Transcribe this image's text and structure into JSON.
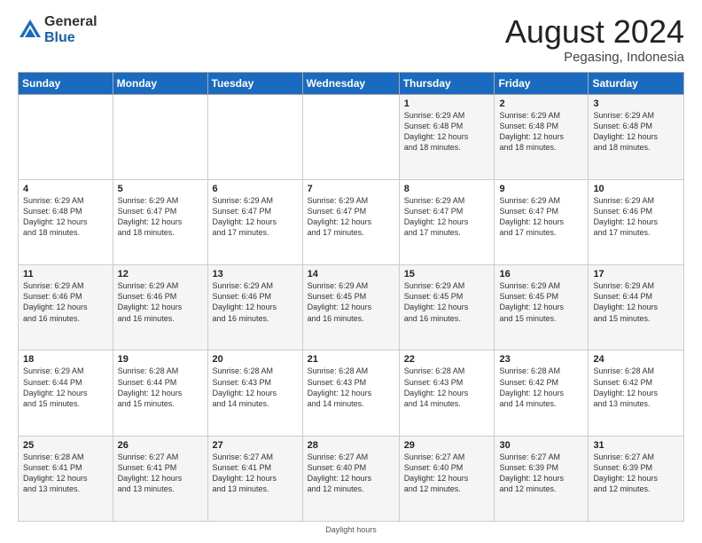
{
  "header": {
    "logo_line1": "General",
    "logo_line2": "Blue",
    "month": "August 2024",
    "location": "Pegasing, Indonesia"
  },
  "days_of_week": [
    "Sunday",
    "Monday",
    "Tuesday",
    "Wednesday",
    "Thursday",
    "Friday",
    "Saturday"
  ],
  "footer": {
    "label": "Daylight hours"
  },
  "weeks": [
    [
      {
        "day": "",
        "info": ""
      },
      {
        "day": "",
        "info": ""
      },
      {
        "day": "",
        "info": ""
      },
      {
        "day": "",
        "info": ""
      },
      {
        "day": "1",
        "info": "Sunrise: 6:29 AM\nSunset: 6:48 PM\nDaylight: 12 hours\nand 18 minutes."
      },
      {
        "day": "2",
        "info": "Sunrise: 6:29 AM\nSunset: 6:48 PM\nDaylight: 12 hours\nand 18 minutes."
      },
      {
        "day": "3",
        "info": "Sunrise: 6:29 AM\nSunset: 6:48 PM\nDaylight: 12 hours\nand 18 minutes."
      }
    ],
    [
      {
        "day": "4",
        "info": "Sunrise: 6:29 AM\nSunset: 6:48 PM\nDaylight: 12 hours\nand 18 minutes."
      },
      {
        "day": "5",
        "info": "Sunrise: 6:29 AM\nSunset: 6:47 PM\nDaylight: 12 hours\nand 18 minutes."
      },
      {
        "day": "6",
        "info": "Sunrise: 6:29 AM\nSunset: 6:47 PM\nDaylight: 12 hours\nand 17 minutes."
      },
      {
        "day": "7",
        "info": "Sunrise: 6:29 AM\nSunset: 6:47 PM\nDaylight: 12 hours\nand 17 minutes."
      },
      {
        "day": "8",
        "info": "Sunrise: 6:29 AM\nSunset: 6:47 PM\nDaylight: 12 hours\nand 17 minutes."
      },
      {
        "day": "9",
        "info": "Sunrise: 6:29 AM\nSunset: 6:47 PM\nDaylight: 12 hours\nand 17 minutes."
      },
      {
        "day": "10",
        "info": "Sunrise: 6:29 AM\nSunset: 6:46 PM\nDaylight: 12 hours\nand 17 minutes."
      }
    ],
    [
      {
        "day": "11",
        "info": "Sunrise: 6:29 AM\nSunset: 6:46 PM\nDaylight: 12 hours\nand 16 minutes."
      },
      {
        "day": "12",
        "info": "Sunrise: 6:29 AM\nSunset: 6:46 PM\nDaylight: 12 hours\nand 16 minutes."
      },
      {
        "day": "13",
        "info": "Sunrise: 6:29 AM\nSunset: 6:46 PM\nDaylight: 12 hours\nand 16 minutes."
      },
      {
        "day": "14",
        "info": "Sunrise: 6:29 AM\nSunset: 6:45 PM\nDaylight: 12 hours\nand 16 minutes."
      },
      {
        "day": "15",
        "info": "Sunrise: 6:29 AM\nSunset: 6:45 PM\nDaylight: 12 hours\nand 16 minutes."
      },
      {
        "day": "16",
        "info": "Sunrise: 6:29 AM\nSunset: 6:45 PM\nDaylight: 12 hours\nand 15 minutes."
      },
      {
        "day": "17",
        "info": "Sunrise: 6:29 AM\nSunset: 6:44 PM\nDaylight: 12 hours\nand 15 minutes."
      }
    ],
    [
      {
        "day": "18",
        "info": "Sunrise: 6:29 AM\nSunset: 6:44 PM\nDaylight: 12 hours\nand 15 minutes."
      },
      {
        "day": "19",
        "info": "Sunrise: 6:28 AM\nSunset: 6:44 PM\nDaylight: 12 hours\nand 15 minutes."
      },
      {
        "day": "20",
        "info": "Sunrise: 6:28 AM\nSunset: 6:43 PM\nDaylight: 12 hours\nand 14 minutes."
      },
      {
        "day": "21",
        "info": "Sunrise: 6:28 AM\nSunset: 6:43 PM\nDaylight: 12 hours\nand 14 minutes."
      },
      {
        "day": "22",
        "info": "Sunrise: 6:28 AM\nSunset: 6:43 PM\nDaylight: 12 hours\nand 14 minutes."
      },
      {
        "day": "23",
        "info": "Sunrise: 6:28 AM\nSunset: 6:42 PM\nDaylight: 12 hours\nand 14 minutes."
      },
      {
        "day": "24",
        "info": "Sunrise: 6:28 AM\nSunset: 6:42 PM\nDaylight: 12 hours\nand 13 minutes."
      }
    ],
    [
      {
        "day": "25",
        "info": "Sunrise: 6:28 AM\nSunset: 6:41 PM\nDaylight: 12 hours\nand 13 minutes."
      },
      {
        "day": "26",
        "info": "Sunrise: 6:27 AM\nSunset: 6:41 PM\nDaylight: 12 hours\nand 13 minutes."
      },
      {
        "day": "27",
        "info": "Sunrise: 6:27 AM\nSunset: 6:41 PM\nDaylight: 12 hours\nand 13 minutes."
      },
      {
        "day": "28",
        "info": "Sunrise: 6:27 AM\nSunset: 6:40 PM\nDaylight: 12 hours\nand 12 minutes."
      },
      {
        "day": "29",
        "info": "Sunrise: 6:27 AM\nSunset: 6:40 PM\nDaylight: 12 hours\nand 12 minutes."
      },
      {
        "day": "30",
        "info": "Sunrise: 6:27 AM\nSunset: 6:39 PM\nDaylight: 12 hours\nand 12 minutes."
      },
      {
        "day": "31",
        "info": "Sunrise: 6:27 AM\nSunset: 6:39 PM\nDaylight: 12 hours\nand 12 minutes."
      }
    ]
  ]
}
